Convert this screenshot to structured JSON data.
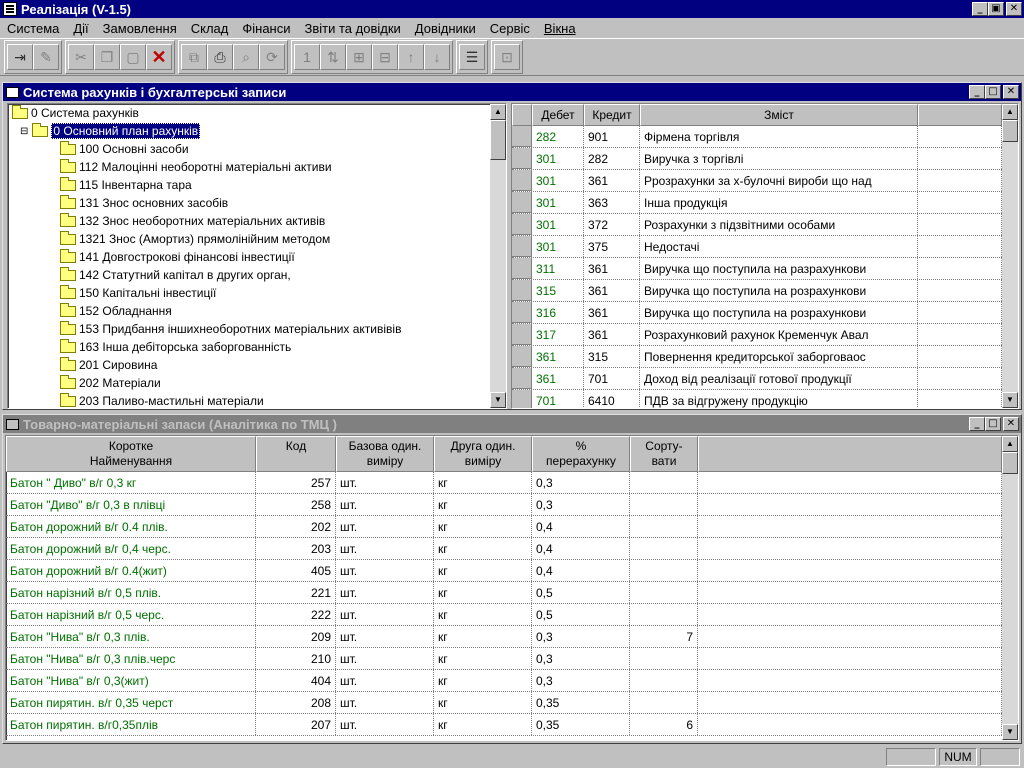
{
  "app": {
    "title": "Реалізація (V-1.5)"
  },
  "window_buttons": {
    "min": "_",
    "max": "▣",
    "close": "✕"
  },
  "menu": [
    "Система",
    "Дії",
    "Замовлення",
    "Склад",
    "Фінанси",
    "Звіти та довідки",
    "Довідники",
    "Сервіс",
    "Вікна"
  ],
  "toolbar": {
    "icons": [
      "enter-icon",
      "pencil-icon",
      "scissors-icon",
      "copy-icon",
      "paste-icon",
      "delete-icon",
      "copy-record-icon",
      "print-icon",
      "find-icon",
      "refresh-icon",
      "one-icon",
      "sort-icon",
      "filter-icon",
      "filter2-icon",
      "sort-asc-icon",
      "sort-desc-icon",
      "list-icon",
      "calc-icon"
    ],
    "delete_glyph": "✕",
    "one_glyph": "1"
  },
  "accounts_panel": {
    "title": "Система рахунків і бухгалтерські записи",
    "tree": {
      "root": "0 Система рахунків",
      "plan": "0 Основний план рахунків",
      "items": [
        "100 Основні засоби",
        "112 Малоцінні необоротні матеріальні активи",
        "115 Інвентарна тара",
        "131 Знос  основних засобів",
        "132 Знос необоротних матеріальних активів",
        "1321 Знос (Амортиз) прямолінійним методом",
        "141 Довгострокові фінансові інвестиції",
        "142 Статутний капітал в других орган,",
        "150 Капітальні інвестиції",
        "152 Обладнання",
        "153 Придбання іншихнеоборотних матеріальних активівів",
        "163 Інша дебіторська заборгованність",
        "201 Сировина",
        "202 Матеріали",
        "203 Паливо-мастильні матеріали"
      ]
    },
    "entries_table": {
      "headers": [
        "Дебет",
        "Кредит",
        "Зміст"
      ],
      "rows": [
        [
          "282",
          "901",
          "Фірмена торгівля"
        ],
        [
          "301",
          "282",
          "Виручка  з торгівлі"
        ],
        [
          "301",
          "361",
          "Ррозрахунки за х-булочні вироби  що над"
        ],
        [
          "301",
          "363",
          "Інша продукція"
        ],
        [
          "301",
          "372",
          "Розрахунки з підзвітними особами"
        ],
        [
          "301",
          "375",
          "Недостачі"
        ],
        [
          "311",
          "361",
          "Виручка   що поступила на разрахункови"
        ],
        [
          "315",
          "361",
          "Виручка  що поступила на розрахункови"
        ],
        [
          "316",
          "361",
          "Виручка  що поступила на розрахункови"
        ],
        [
          "317",
          "361",
          "Розрахунковий рахунок Кременчук Авал"
        ],
        [
          "361",
          "315",
          "Повернення кредиторської заборговаос"
        ],
        [
          "361",
          "701",
          "Доход від реалізації  готової продукції"
        ],
        [
          "701",
          "6410",
          "ПДВ  за  відгружену продукцію"
        ]
      ]
    }
  },
  "goods_panel": {
    "title": "Товарно-матеріальні запаси  (Аналітика по ТМЦ )",
    "headers": {
      "name": [
        "Коротке",
        "Найменування"
      ],
      "code": [
        "Код"
      ],
      "base_unit": [
        "Базова один.",
        "виміру"
      ],
      "second_unit": [
        "Друга один.",
        "виміру"
      ],
      "percent": [
        "%",
        "перерахунку"
      ],
      "sort": [
        "Сорту-",
        "вати"
      ]
    },
    "rows": [
      {
        "name": "Батон \" Диво\"  в/г 0,3 кг",
        "code": "257",
        "base": "шт.",
        "second": "кг",
        "pct": "0,3",
        "sort": ""
      },
      {
        "name": "Батон \"Диво\" в/г 0,3 в плівці",
        "code": "258",
        "base": "шт.",
        "second": "кг",
        "pct": "0,3",
        "sort": ""
      },
      {
        "name": "Батон дорожний в/г 0.4 плів.",
        "code": "202",
        "base": "шт.",
        "second": "кг",
        "pct": "0,4",
        "sort": ""
      },
      {
        "name": "Батон дорожний в/г 0,4 черс.",
        "code": "203",
        "base": "шт.",
        "second": "кг",
        "pct": "0,4",
        "sort": ""
      },
      {
        "name": "Батон дорожний в/г 0.4(жит)",
        "code": "405",
        "base": "шт.",
        "second": "кг",
        "pct": "0,4",
        "sort": ""
      },
      {
        "name": "Батон нарізний  в/г 0,5 плів.",
        "code": "221",
        "base": "шт.",
        "second": "кг",
        "pct": "0,5",
        "sort": ""
      },
      {
        "name": "Батон нарізний  в/г 0,5 черс.",
        "code": "222",
        "base": "шт.",
        "second": "кг",
        "pct": "0,5",
        "sort": ""
      },
      {
        "name": "Батон \"Нива\" в/г 0,3 плів.",
        "code": "209",
        "base": "шт.",
        "second": "кг",
        "pct": "0,3",
        "sort": "7"
      },
      {
        "name": "Батон \"Нива\" в/г 0,3 плів.черс",
        "code": "210",
        "base": "шт.",
        "second": "кг",
        "pct": "0,3",
        "sort": ""
      },
      {
        "name": "Батон \"Нива\" в/г 0,3(жит)",
        "code": "404",
        "base": "шт.",
        "second": "кг",
        "pct": "0,3",
        "sort": ""
      },
      {
        "name": "Батон пирятин. в/г  0,35 черст",
        "code": "208",
        "base": "шт.",
        "second": "кг",
        "pct": "0,35",
        "sort": ""
      },
      {
        "name": "Батон пирятин. в/г0,35плів",
        "code": "207",
        "base": "шт.",
        "second": "кг",
        "pct": "0,35",
        "sort": "6"
      }
    ]
  },
  "status": {
    "num": "NUM"
  },
  "colors": {
    "title_active": "#000080",
    "title_inactive": "#808080",
    "account_code": "#007000",
    "goods_name": "#007000",
    "delete_icon": "#c00000"
  }
}
